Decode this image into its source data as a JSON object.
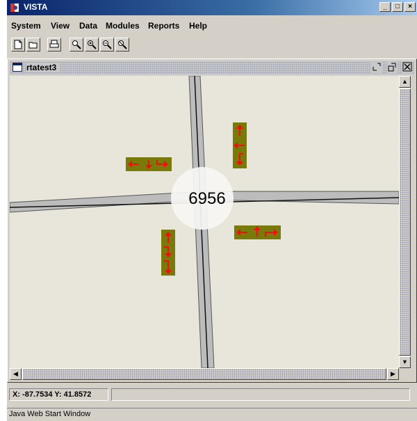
{
  "window": {
    "title": "VISTA",
    "minimize": "_",
    "maximize": "□",
    "close": "×"
  },
  "menu": [
    {
      "label": "System"
    },
    {
      "label": "View"
    },
    {
      "label": "Data"
    },
    {
      "label": "Modules"
    },
    {
      "label": "Reports"
    },
    {
      "label": "Help"
    }
  ],
  "toolbar": {
    "buttons": [
      "new-icon",
      "open-icon",
      "print-icon",
      "zoom-icon",
      "zoom-in-icon",
      "zoom-out-icon",
      "zoom-reset-icon"
    ]
  },
  "frame": {
    "title": "rtatest3"
  },
  "map": {
    "intersection_count": "6956",
    "road_color": "#bcbcbc",
    "centerline_color": "#111111",
    "background_color": "#e8e6db",
    "signal_box_color": "#7a7a0a",
    "arrow_color": "#ee1111"
  },
  "status": {
    "coordinates": "X: -87.7534 Y: 41.8572"
  },
  "footer": {
    "text": "Java Web Start Window"
  }
}
